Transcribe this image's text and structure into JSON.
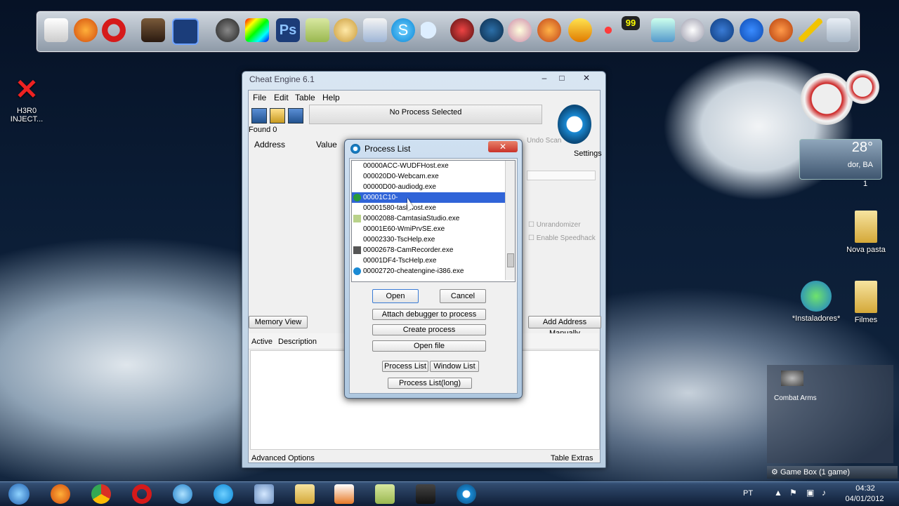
{
  "colors": {
    "selection": "#3064d8",
    "close_red": "#c9332a",
    "accent_blue": "#22528f"
  },
  "dock": {
    "icons": [
      "folder-icon",
      "firefox-icon",
      "opera-icon",
      "game-icon",
      "photoshop-bridge-icon",
      "cheatengine-icon",
      "color-icon",
      "photoshop-icon",
      "notepad-icon",
      "settings-icon",
      "mail-icon",
      "skype-icon",
      "moon-icon",
      "game-icon",
      "gear-icon",
      "paint-icon",
      "flame-icon",
      "bug-icon",
      "winamp-icon",
      "computer-icon",
      "tools-icon",
      "avast-icon",
      "flash-icon",
      "hand-icon",
      "plane-icon",
      "trash-icon"
    ],
    "badge": "99"
  },
  "desktop": {
    "inject": {
      "label_line1": "H3R0",
      "label_line2": "INJECT..."
    },
    "weather": {
      "temp": "28°",
      "city": "dor, BA",
      "page": "1"
    },
    "nova_pasta": "Nova pasta",
    "instaladores": "*Instaladores*",
    "filmes": "Filmes",
    "combat_arms": "Combat Arms",
    "gamebox": {
      "label": "Game Box",
      "count": "(1 game)"
    }
  },
  "ce": {
    "title": "Cheat Engine 6.1",
    "menu": [
      "File",
      "Edit",
      "Table",
      "Help"
    ],
    "process_status": "No Process Selected",
    "found": "Found 0",
    "col_address": "Address",
    "col_value": "Value",
    "undo_scan": "Undo Scan",
    "settings": "Settings",
    "unrandomizer": "Unrandomizer",
    "speedhack": "Enable Speedhack",
    "memory_view": "Memory View",
    "add_address": "Add Address Manually",
    "col_active": "Active",
    "col_description": "Description",
    "advanced_options": "Advanced Options",
    "table_extras": "Table Extras"
  },
  "process_dialog": {
    "title": "Process List",
    "processes": [
      "00000ACC-WUDFHost.exe",
      "000020D0-Webcam.exe",
      "00000D00-audiodg.exe",
      "00001C10-",
      "00001580-taskhost.exe",
      "00002088-CamtasiaStudio.exe",
      "00001E60-WmiPrvSE.exe",
      "00002330-TscHelp.exe",
      "00002678-CamRecorder.exe",
      "00001DF4-TscHelp.exe",
      "00002720-cheatengine-i386.exe"
    ],
    "open": "Open",
    "cancel": "Cancel",
    "attach_debugger": "Attach debugger to process",
    "create_process": "Create process",
    "open_file": "Open file",
    "process_list": "Process List",
    "window_list": "Window List",
    "process_list_long": "Process List(long)"
  },
  "taskbar": {
    "lang": "PT",
    "time": "04:32",
    "date": "04/01/2012"
  }
}
